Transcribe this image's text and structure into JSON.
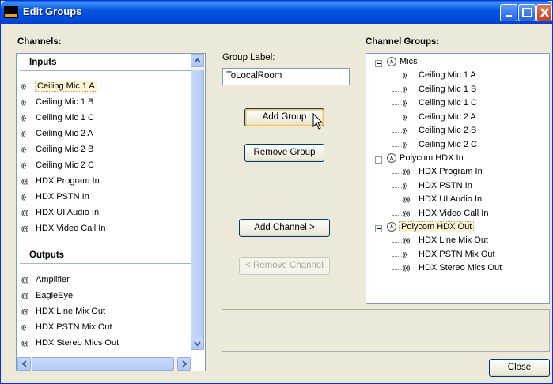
{
  "window": {
    "title": "Edit Groups"
  },
  "channels": {
    "label": "Channels:",
    "inputs_header": "Inputs",
    "outputs_header": "Outputs",
    "inputs": [
      {
        "label": "Ceiling Mic 1 A",
        "icon": "((•"
      },
      {
        "label": "Ceiling Mic 1 B",
        "icon": "((•"
      },
      {
        "label": "Ceiling Mic 1 C",
        "icon": "((•"
      },
      {
        "label": "Ceiling Mic 2 A",
        "icon": "((•"
      },
      {
        "label": "Ceiling Mic 2 B",
        "icon": "((•"
      },
      {
        "label": "Ceiling Mic 2 C",
        "icon": "((•"
      },
      {
        "label": "HDX Program In",
        "icon": "((•))"
      },
      {
        "label": "HDX PSTN In",
        "icon": "((•"
      },
      {
        "label": "HDX UI Audio In",
        "icon": "((•))"
      },
      {
        "label": "HDX Video Call In",
        "icon": "((•))"
      }
    ],
    "outputs": [
      {
        "label": "Amplifier",
        "icon": "((•))"
      },
      {
        "label": "EagleEye",
        "icon": "((•))"
      },
      {
        "label": "HDX Line Mix Out",
        "icon": "((•))"
      },
      {
        "label": "HDX PSTN Mix Out",
        "icon": "((•"
      },
      {
        "label": "HDX Stereo Mics Out",
        "icon": "((•))"
      }
    ]
  },
  "group_label": {
    "label": "Group Label:",
    "value": "ToLocalRoom"
  },
  "buttons": {
    "add_group": "Add Group",
    "remove_group": "Remove Group",
    "add_channel": "Add Channel >",
    "remove_channel": "< Remove Channel",
    "close": "Close"
  },
  "channel_groups": {
    "label": "Channel Groups:",
    "groups": [
      {
        "name": "Mics",
        "items": [
          "Ceiling Mic 1 A",
          "Ceiling Mic 1 B",
          "Ceiling Mic 1 C",
          "Ceiling Mic 2 A",
          "Ceiling Mic 2 B",
          "Ceiling Mic 2 C"
        ],
        "icons": [
          "((•",
          "((•",
          "((•",
          "((•",
          "((•",
          "((•"
        ]
      },
      {
        "name": "Polycom HDX In",
        "items": [
          "HDX Program In",
          "HDX PSTN In",
          "HDX UI Audio In",
          "HDX Video Call In"
        ],
        "icons": [
          "((•))",
          "((•",
          "((•))",
          "((•))"
        ]
      },
      {
        "name": "Polycom HDX Out",
        "items": [
          "HDX Line Mix Out",
          "HDX PSTN Mix Out",
          "HDX Stereo Mics Out"
        ],
        "icons": [
          "((•))",
          "((•",
          "((•))"
        ]
      }
    ]
  },
  "colors": {
    "titlebar": "#0456e0",
    "selection": "#fdf3d0",
    "border": "#7f9db9",
    "face": "#ece9d8"
  }
}
